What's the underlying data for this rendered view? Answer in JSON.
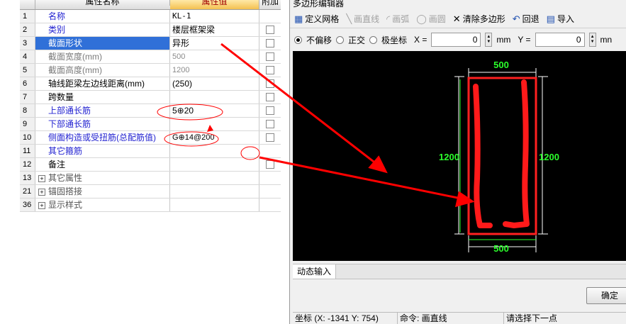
{
  "grid": {
    "header": {
      "name": "属性名称",
      "value": "属性值",
      "add": "附加"
    },
    "rows": [
      {
        "idx": "1",
        "name": "名称",
        "value": "KL-1"
      },
      {
        "idx": "2",
        "name": "类别",
        "value": "楼层框架梁"
      },
      {
        "idx": "3",
        "name": "截面形状",
        "value": "异形"
      },
      {
        "idx": "4",
        "name": "截面宽度(mm)",
        "value": "500"
      },
      {
        "idx": "5",
        "name": "截面高度(mm)",
        "value": "1200"
      },
      {
        "idx": "6",
        "name": "轴线距梁左边线距离(mm)",
        "value": "(250)"
      },
      {
        "idx": "7",
        "name": "跨数量",
        "value": ""
      },
      {
        "idx": "8",
        "name": "上部通长筋",
        "value": "5⊕20"
      },
      {
        "idx": "9",
        "name": "下部通长筋",
        "value": ""
      },
      {
        "idx": "10",
        "name": "侧面构造或受扭筋(总配筋值)",
        "value": "G⊕14@200"
      },
      {
        "idx": "11",
        "name": "其它箍筋",
        "value": ""
      },
      {
        "idx": "12",
        "name": "备注",
        "value": ""
      },
      {
        "idx": "13",
        "name": "其它属性",
        "value": ""
      },
      {
        "idx": "21",
        "name": "锚固搭接",
        "value": ""
      },
      {
        "idx": "36",
        "name": "显示样式",
        "value": ""
      }
    ]
  },
  "editor": {
    "title": "多边形编辑器",
    "toolbar": {
      "define_grid": "定义网格",
      "draw_line": "画直线",
      "draw_arc": "画弧",
      "draw_circle": "画圆",
      "clear_polygon": "清除多边形",
      "undo": "回退",
      "import": "导入"
    },
    "coords": {
      "no_offset": "不偏移",
      "orthogonal": "正交",
      "polar": "极坐标",
      "x_label": "X =",
      "x_value": "0",
      "x_unit": "mm",
      "y_label": "Y =",
      "y_value": "0",
      "y_unit": "mn"
    },
    "drawing": {
      "width_top": "500",
      "width_bottom": "500",
      "height_left": "1200",
      "height_right": "1200"
    },
    "dynamic_input_tab": "动态输入",
    "ok_button": "确定",
    "status": {
      "coords": "坐标 (X: -1341 Y: 754)",
      "command": "命令: 画直线",
      "prompt": "请选择下一点"
    },
    "colors": {
      "canvas_bg": "#000000",
      "dimension_text": "#2bff2b",
      "shape_outline": "#ff2020",
      "dimension_lines": "#ffffff"
    }
  }
}
